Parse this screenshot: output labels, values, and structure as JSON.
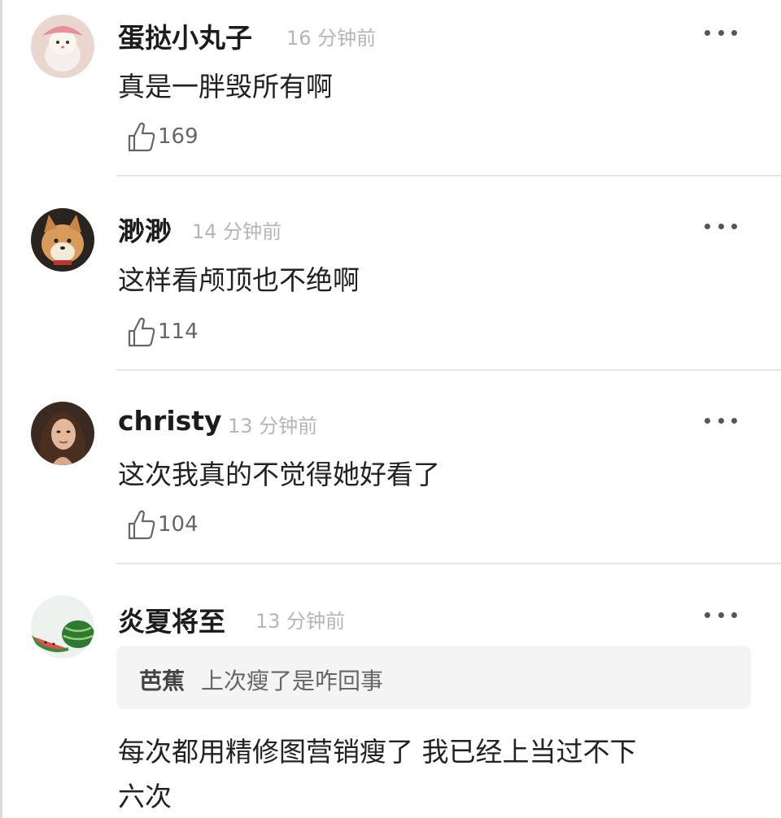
{
  "comments": [
    {
      "username": "蛋挞小丸子",
      "time": "16 分钟前",
      "text": "真是一胖毁所有啊",
      "likes": "169",
      "avatar_icon": "cat-avatar"
    },
    {
      "username": "渺渺",
      "time": "14 分钟前",
      "text": "这样看颅顶也不绝啊",
      "likes": "114",
      "avatar_icon": "shiba-dog-avatar"
    },
    {
      "username": "christy",
      "time": "13 分钟前",
      "text": "这次我真的不觉得她好看了",
      "likes": "104",
      "avatar_icon": "woman-portrait-avatar"
    },
    {
      "username": "炎夏将至",
      "time": "13 分钟前",
      "avatar_icon": "watermelon-avatar",
      "reply_to": {
        "user": "芭蕉",
        "text": "上次瘦了是咋回事"
      },
      "text_line1": "每次都用精修图营销瘦了 我已经上当过不下",
      "text_line2": "六次"
    }
  ],
  "icons": {
    "like": "thumbs-up-icon",
    "more": "more-dots-icon"
  },
  "colors": {
    "username": "#1c1c1c",
    "time": "#b5b5b5",
    "divider": "#e6e6e6",
    "quote_bg": "#f4f4f4"
  }
}
